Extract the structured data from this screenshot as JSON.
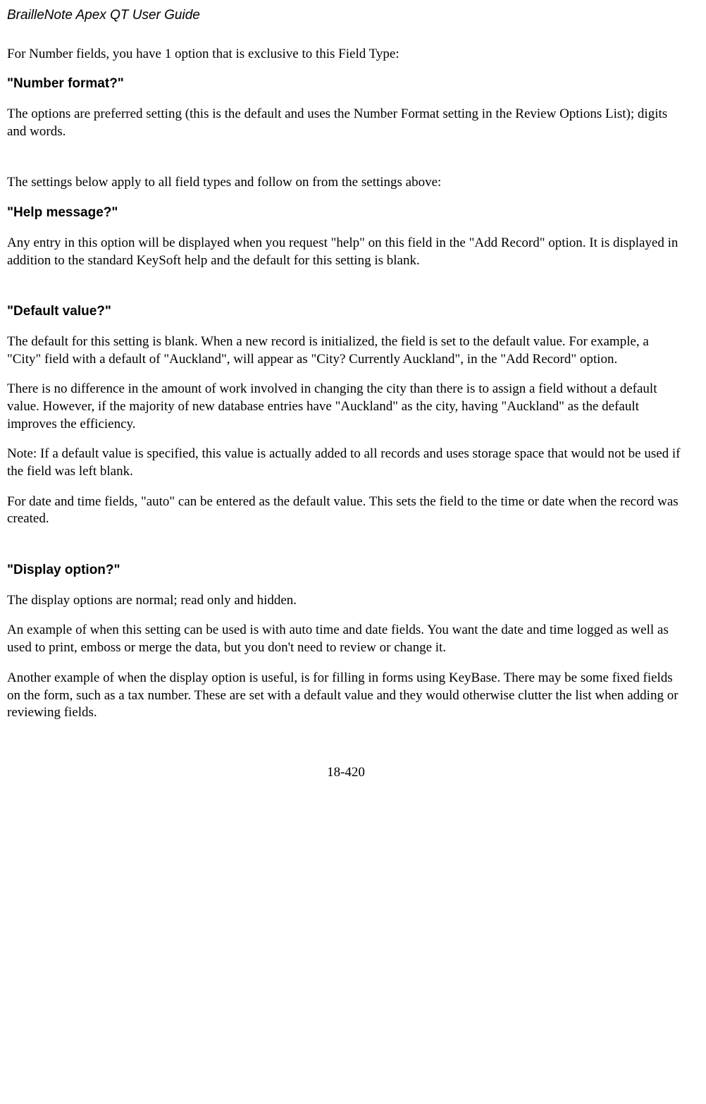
{
  "header": {
    "title": "BrailleNote Apex QT User Guide"
  },
  "intro": {
    "p1": "For Number fields, you have 1 option that is exclusive to this Field Type:"
  },
  "sections": {
    "numberFormat": {
      "heading": "\"Number format?\"",
      "p1": "The options are preferred setting (this is the default and uses the Number Format setting in the Review Options List); digits and words."
    },
    "transition": {
      "p1": "The settings below apply to all field types and follow on from the settings above:"
    },
    "helpMessage": {
      "heading": "\"Help message?\"",
      "p1": "Any entry in this option will be displayed when you request \"help\" on this field in the \"Add Record\" option. It is displayed in addition to the standard KeySoft help and the default for this setting is blank."
    },
    "defaultValue": {
      "heading": "\"Default value?\"",
      "p1": "The default for this setting is blank. When a new record is initialized, the field is set to the default value. For example, a \"City\" field with a default of \"Auckland\", will appear as \"City? Currently Auckland\", in the \"Add Record\" option.",
      "p2": "There is no difference in the amount of work involved in changing the city than there is to assign a field without a default value. However, if the majority of new database entries have \"Auckland\" as the city, having \"Auckland\" as the default improves the efficiency.",
      "p3": "Note: If a default value is specified, this value is actually added to all records and uses storage space that would not be used if the field was left blank.",
      "p4": "For date and time fields, \"auto\" can be entered as the default value. This sets the field to the time or date when the record was created."
    },
    "displayOption": {
      "heading": "\"Display option?\"",
      "p1": "The display options are normal; read only and hidden.",
      "p2": "An example of when this setting can be used is with auto time and date fields. You want the date and time logged as well as used to print, emboss or merge the data, but you don't need to review or change it.",
      "p3": "Another example of when the display option is useful, is for filling in forms using KeyBase. There may be some fixed fields on the form, such as a tax number. These are set with a default value and they would otherwise clutter the list when adding or reviewing fields."
    }
  },
  "footer": {
    "pageNumber": "18-420"
  }
}
